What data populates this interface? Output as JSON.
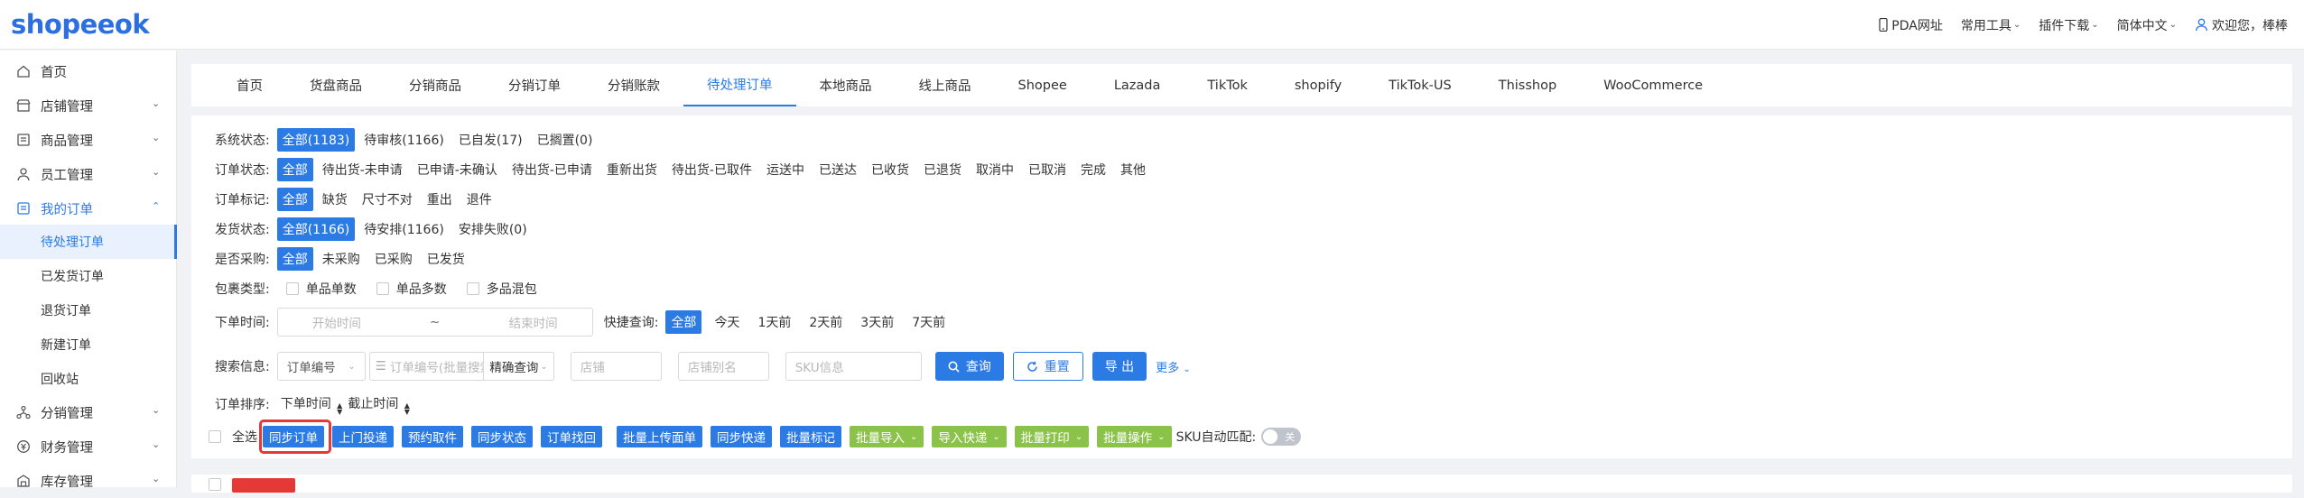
{
  "header": {
    "logo": "shopeeok",
    "links": [
      {
        "label": "PDA网址",
        "icon": "mobile-icon"
      },
      {
        "label": "常用工具",
        "dropdown": true
      },
      {
        "label": "插件下载",
        "dropdown": true
      },
      {
        "label": "简体中文",
        "dropdown": true
      }
    ],
    "user_greeting": "欢迎您，棒棒"
  },
  "sidebar": {
    "items": [
      {
        "label": "首页",
        "icon": "home-icon"
      },
      {
        "label": "店铺管理",
        "icon": "store-icon"
      },
      {
        "label": "商品管理",
        "icon": "product-icon"
      },
      {
        "label": "员工管理",
        "icon": "staff-icon"
      },
      {
        "label": "我的订单",
        "icon": "order-icon"
      },
      {
        "label": "分销管理",
        "icon": "distribution-icon"
      },
      {
        "label": "财务管理",
        "icon": "finance-icon"
      },
      {
        "label": "库存管理",
        "icon": "inventory-icon"
      }
    ],
    "sub_items": [
      "待处理订单",
      "已发货订单",
      "退货订单",
      "新建订单",
      "回收站"
    ]
  },
  "tabs": [
    "首页",
    "货盘商品",
    "分销商品",
    "分销订单",
    "分销账款",
    "待处理订单",
    "本地商品",
    "线上商品",
    "Shopee",
    "Lazada",
    "TikTok",
    "shopify",
    "TikTok-US",
    "Thisshop",
    "WooCommerce"
  ],
  "filters": {
    "system_status": {
      "label": "系统状态:",
      "options": [
        "全部(1183)",
        "待审核(1166)",
        "已自发(17)",
        "已搁置(0)"
      ]
    },
    "order_status": {
      "label": "订单状态:",
      "options": [
        "全部",
        "待出货-未申请",
        "已申请-未确认",
        "待出货-已申请",
        "重新出货",
        "待出货-已取件",
        "运送中",
        "已送达",
        "已收货",
        "已退货",
        "取消中",
        "已取消",
        "完成",
        "其他"
      ]
    },
    "order_mark": {
      "label": "订单标记:",
      "options": [
        "全部",
        "缺货",
        "尺寸不对",
        "重出",
        "退件"
      ]
    },
    "ship_status": {
      "label": "发货状态:",
      "options": [
        "全部(1166)",
        "待安排(1166)",
        "安排失败(0)"
      ]
    },
    "purchased": {
      "label": "是否采购:",
      "options": [
        "全部",
        "未采购",
        "已采购",
        "已发货"
      ]
    },
    "package_type": {
      "label": "包裹类型:",
      "options": [
        "单品单数",
        "单品多数",
        "多品混包"
      ]
    },
    "order_time": {
      "label": "下单时间:",
      "start_placeholder": "开始时间",
      "separator": "~",
      "end_placeholder": "结束时间"
    },
    "quick_query": {
      "label": "快捷查询:",
      "options": [
        "全部",
        "今天",
        "1天前",
        "2天前",
        "3天前",
        "7天前"
      ]
    },
    "search": {
      "label": "搜索信息:",
      "field_select": "订单编号",
      "keyword_placeholder": "订单编号(批量搜索用...",
      "match_select": "精确查询",
      "shop_placeholder": "店铺",
      "shop_alias_placeholder": "店铺别名",
      "sku_placeholder": "SKU信息",
      "query_button": "查询",
      "reset_button": "重置",
      "export_button": "导 出",
      "more_link": "更多"
    },
    "sort": {
      "label": "订单排序:",
      "options": [
        "下单时间",
        "截止时间"
      ]
    }
  },
  "actions": {
    "select_all": "全选",
    "blue_buttons": [
      "同步订单",
      "上门投递",
      "预约取件",
      "同步状态",
      "订单找回",
      "批量上传面单",
      "同步快递",
      "批量标记"
    ],
    "green_buttons": [
      "批量导入",
      "导入快递",
      "批量打印",
      "批量操作"
    ],
    "sku_auto_label": "SKU自动匹配:",
    "toggle_text": "关"
  },
  "colors": {
    "primary": "#2c7be5",
    "green": "#8bc34a",
    "highlight": "#e53935"
  }
}
